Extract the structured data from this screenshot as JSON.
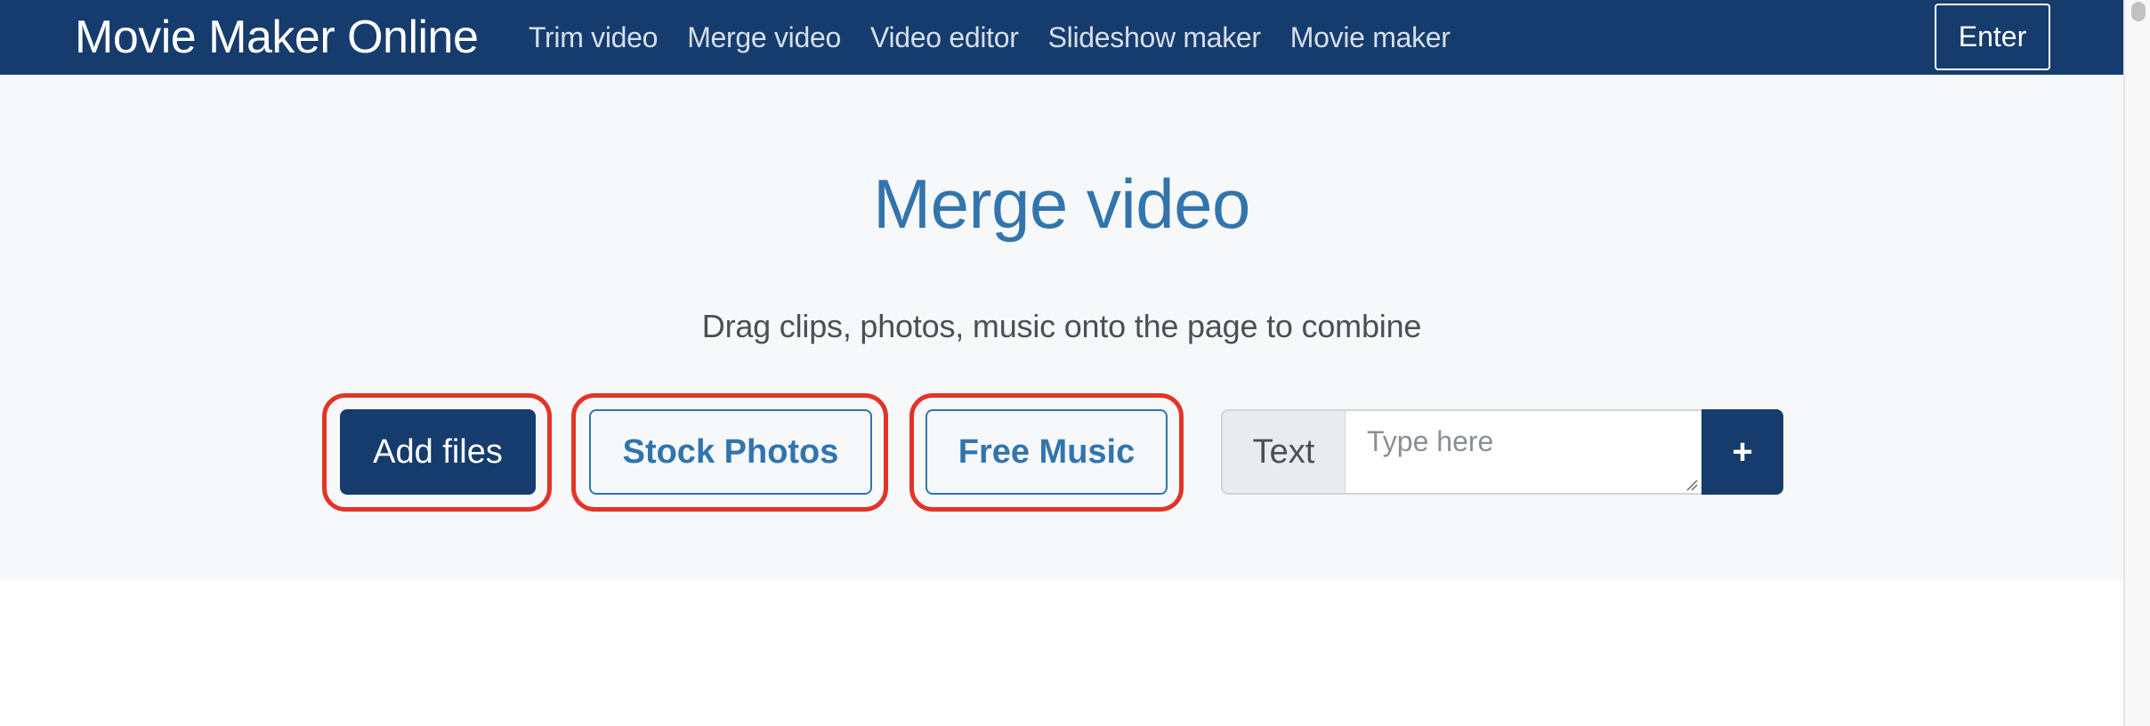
{
  "navbar": {
    "brand": "Movie Maker Online",
    "links": [
      {
        "label": "Trim video"
      },
      {
        "label": "Merge video"
      },
      {
        "label": "Video editor"
      },
      {
        "label": "Slideshow maker"
      },
      {
        "label": "Movie maker"
      }
    ],
    "enter_label": "Enter"
  },
  "hero": {
    "title": "Merge video",
    "subtitle": "Drag clips, photos, music onto the page to combine",
    "buttons": {
      "add_files": "Add files",
      "stock_photos": "Stock Photos",
      "free_music": "Free Music"
    },
    "text_input": {
      "label": "Text",
      "placeholder": "Type here",
      "value": "",
      "add_label": "+"
    }
  },
  "colors": {
    "navbar_bg": "#163c6e",
    "accent_blue": "#3275ad",
    "highlight_ring": "#e33428",
    "hero_bg": "#f7f8fa"
  },
  "icons": {
    "add_text": "plus-icon",
    "resize": "resize-grip-icon"
  }
}
